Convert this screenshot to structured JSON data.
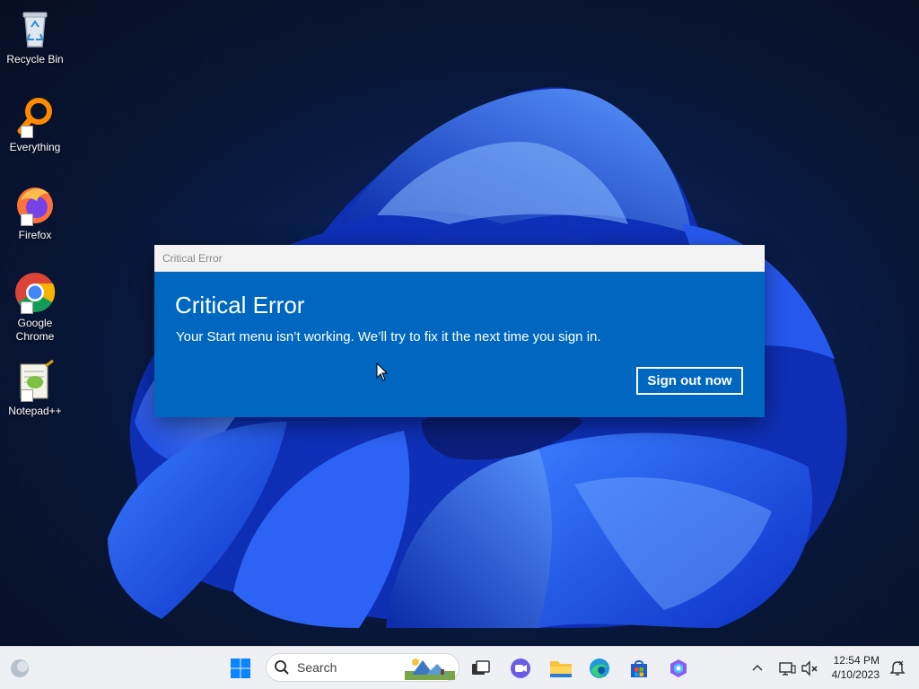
{
  "desktop_icons": [
    {
      "label": "Recycle Bin",
      "icon": "recycle-bin-icon"
    },
    {
      "label": "Everything",
      "icon": "everything-search-icon"
    },
    {
      "label": "Firefox",
      "icon": "firefox-icon"
    },
    {
      "label": "Google Chrome",
      "icon": "chrome-icon"
    },
    {
      "label": "Notepad++",
      "icon": "notepad-plus-plus-icon"
    }
  ],
  "dialog": {
    "window_title": "Critical Error",
    "heading": "Critical Error",
    "message": "Your Start menu isn’t working. We’ll try to fix it the next time you sign in.",
    "button_label": "Sign out now",
    "accent_color": "#0067c0"
  },
  "taskbar": {
    "search_placeholder": "Search",
    "pinned": [
      "start-icon",
      "search-icon",
      "task-view-icon",
      "chat-icon",
      "file-explorer-icon",
      "edge-icon",
      "store-icon",
      "copilot-icon"
    ],
    "clock_time": "12:54 PM",
    "clock_date": "4/10/2023"
  }
}
